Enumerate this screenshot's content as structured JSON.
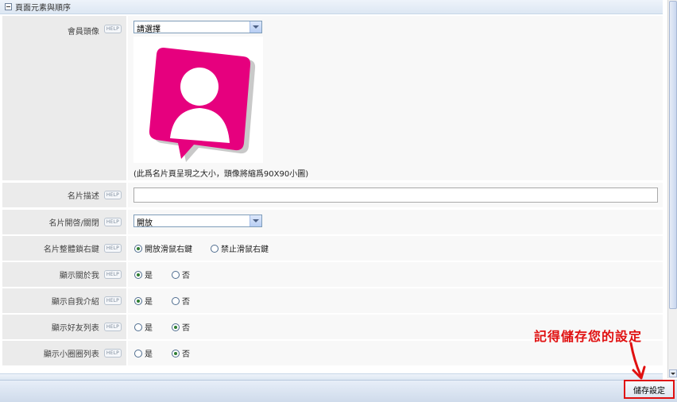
{
  "section": {
    "title": "頁面元素與順序"
  },
  "help_label": "HELP",
  "rows": {
    "avatar": {
      "label": "會員頭像",
      "select_value": "請選擇",
      "note": "(此爲名片頁呈現之大小，頭像將縮爲90X90小圖)",
      "avatar_color": "#e6007e"
    },
    "description": {
      "label": "名片描述",
      "value": ""
    },
    "visibility": {
      "label": "名片開啓/關閉",
      "select_value": "開放"
    },
    "right_click": {
      "label": "名片整體鎖右鍵",
      "options": [
        {
          "label": "開放滑鼠右鍵",
          "checked": true
        },
        {
          "label": "禁止滑鼠右鍵",
          "checked": false
        }
      ]
    },
    "show_about": {
      "label": "顯示關於我",
      "options": [
        {
          "label": "是",
          "checked": true
        },
        {
          "label": "否",
          "checked": false
        }
      ]
    },
    "show_intro": {
      "label": "顯示自我介紹",
      "options": [
        {
          "label": "是",
          "checked": true
        },
        {
          "label": "否",
          "checked": false
        }
      ]
    },
    "show_friends": {
      "label": "顯示好友列表",
      "options": [
        {
          "label": "是",
          "checked": false
        },
        {
          "label": "否",
          "checked": true
        }
      ]
    },
    "show_circles": {
      "label": "顯示小圈圈列表",
      "options": [
        {
          "label": "是",
          "checked": false
        },
        {
          "label": "否",
          "checked": true
        }
      ]
    }
  },
  "footer": {
    "save_label": "儲存設定"
  },
  "annotation": {
    "text": "記得儲存您的設定",
    "color": "#e01010"
  }
}
